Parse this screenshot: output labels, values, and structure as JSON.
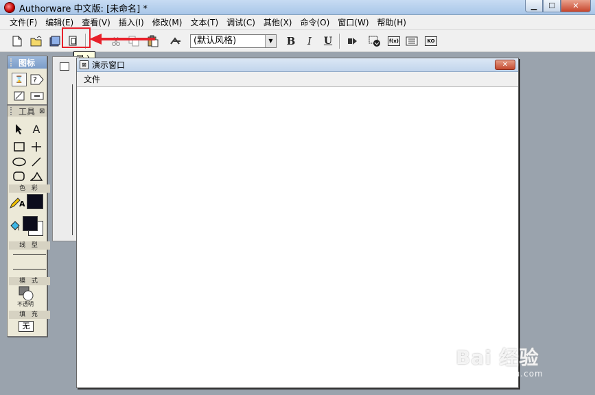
{
  "window": {
    "title": "Authorware 中文版: [未命名] *",
    "min": "▁",
    "max": "☐",
    "close": "✕"
  },
  "menubar": [
    "文件(F)",
    "编辑(E)",
    "查看(V)",
    "插入(I)",
    "修改(M)",
    "文本(T)",
    "调试(C)",
    "其他(X)",
    "命令(O)",
    "窗口(W)",
    "帮助(H)"
  ],
  "toolbar": {
    "style_combo": "(默认风格)",
    "bold": "B",
    "italic": "I",
    "underline": "U",
    "import_tooltip": "导入",
    "fx_label": "f(x)",
    "ko_label": "KO"
  },
  "icons_palette": {
    "title": "图标"
  },
  "tools_palette": {
    "title": "工具",
    "color_label": "色 彩",
    "line_label": "线 型",
    "mode_label": "模 式",
    "mode_value": "不透明",
    "fill_label": "填 充",
    "fill_value": "无",
    "text_tool": "A"
  },
  "presentation_window": {
    "title": "演示窗口",
    "menu_file": "文件"
  },
  "watermark": {
    "main": "Bai 经验",
    "sub": "jingyan.baidu.com"
  },
  "colors": {
    "highlight": "#e8202a",
    "swatch": "#0c0c1c"
  }
}
